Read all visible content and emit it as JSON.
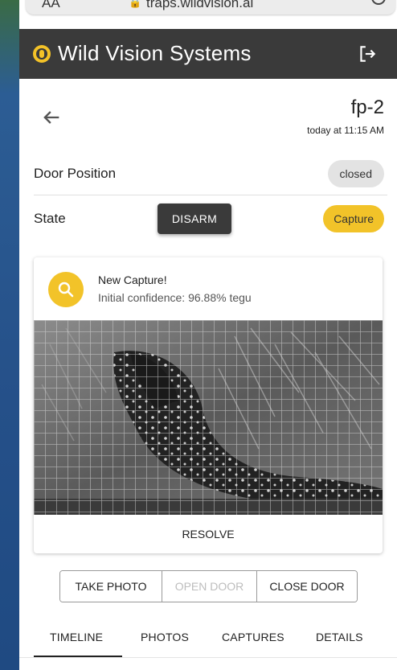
{
  "browser": {
    "aa_label": "AA",
    "url": "traps.wildvision.ai"
  },
  "header": {
    "title": "Wild Vision Systems",
    "logo_icon": "shield-logo-icon",
    "logout_icon": "logout-icon",
    "background_color": "#3a3a3a",
    "accent_color": "#f2c329"
  },
  "device": {
    "name": "fp-2",
    "updated": "today at 11:15 AM"
  },
  "door_position": {
    "label": "Door Position",
    "value": "closed"
  },
  "state": {
    "label": "State",
    "action_label": "DISARM",
    "value": "Capture"
  },
  "capture_card": {
    "title": "New Capture!",
    "confidence": "Initial confidence: 96.88% tegu",
    "icon": "search-icon",
    "photo_subject": "tegu lizard inside wire cage trap (grayscale night image)",
    "resolve_label": "RESOLVE"
  },
  "controls": {
    "take_photo": "TAKE PHOTO",
    "open_door": "OPEN DOOR",
    "close_door": "CLOSE DOOR",
    "open_door_disabled": true
  },
  "tabs": {
    "items": [
      {
        "label": "TIMELINE",
        "active": true
      },
      {
        "label": "PHOTOS",
        "active": false
      },
      {
        "label": "CAPTURES",
        "active": false
      },
      {
        "label": "DETAILS",
        "active": false
      }
    ]
  }
}
